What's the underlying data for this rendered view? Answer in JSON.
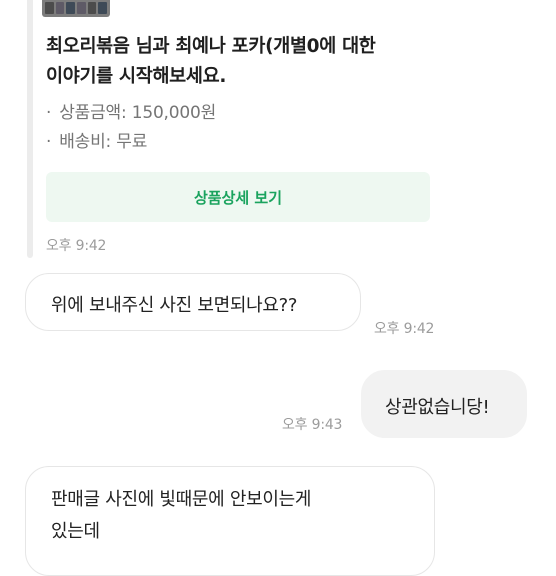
{
  "product_card": {
    "title_line1": "최오리볶음 님과 최예나 포카(개별0에 대한",
    "title_line2": "이야기를 시작해보세요.",
    "price_label": "상품금액: 150,000원",
    "shipping_label": "배송비: 무료",
    "bullet": "·",
    "detail_button": "상품상세 보기",
    "time": "오후 9:42"
  },
  "messages": [
    {
      "direction": "incoming",
      "lines": [
        "위에 보내주신 사진 보면되나요??"
      ],
      "time": "오후 9:42"
    },
    {
      "direction": "outgoing",
      "lines": [
        "상관없습니당!"
      ],
      "time": "오후 9:43"
    },
    {
      "direction": "incoming",
      "lines": [
        "판매글 사진에 빛때문에 안보이는게",
        "있는데"
      ],
      "time": ""
    }
  ],
  "colors": {
    "accent_green": "#1aa35e",
    "button_bg": "#eef8f1",
    "outgoing_bubble": "#f2f2f2",
    "timestamp": "#9c9c9c"
  }
}
